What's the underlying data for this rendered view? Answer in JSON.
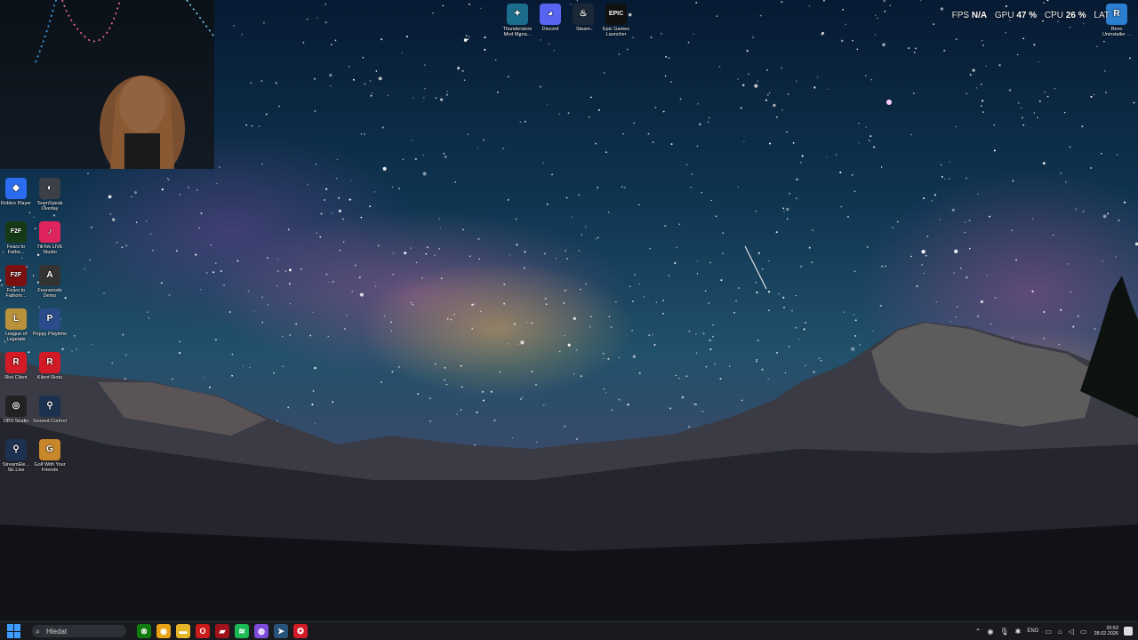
{
  "desktop": {
    "left_icons": [
      {
        "label": "Roblox Player",
        "color": "#2c6cf2",
        "glyph": "◆",
        "name": "roblox-player"
      },
      {
        "label": "TeamSpeak Overlay",
        "color": "#3b3f46",
        "glyph": "◐",
        "name": "teamspeak-overlay"
      },
      {
        "label": "Fears to Fatho...",
        "color": "#153a15",
        "glyph": "F2F",
        "name": "fears-to-fathom-1"
      },
      {
        "label": "TikTok LIVE Studio",
        "color": "#e0245e",
        "glyph": "♪",
        "name": "tiktok-live-studio"
      },
      {
        "label": "Fears to Fathom...",
        "color": "#7a1010",
        "glyph": "F2F",
        "name": "fears-to-fathom-2"
      },
      {
        "label": "Fearwoods Demo",
        "color": "#333",
        "glyph": "A",
        "name": "fearwoods-demo"
      },
      {
        "label": "League of Legends",
        "color": "#b8913a",
        "glyph": "L",
        "name": "league-of-legends"
      },
      {
        "label": "Poppy Playtime",
        "color": "#2a4c8c",
        "glyph": "P",
        "name": "poppy-playtime"
      },
      {
        "label": "Riot Client",
        "color": "#d21b27",
        "glyph": "R",
        "name": "riot-client"
      },
      {
        "label": "Klient Riotu",
        "color": "#d21b27",
        "glyph": "R",
        "name": "klient-riotu"
      },
      {
        "label": "OBS Studio",
        "color": "#222",
        "glyph": "◎",
        "name": "obs-studio"
      },
      {
        "label": "Ground Control",
        "color": "#1d3250",
        "glyph": "⚲",
        "name": "ground-control"
      },
      {
        "label": "StreamEle... SE.Live",
        "color": "#1d3250",
        "glyph": "⚲",
        "name": "streamelements-selive"
      },
      {
        "label": "Golf With Your Friends",
        "color": "#c8872a",
        "glyph": "G",
        "name": "golf-with-your-friends"
      }
    ],
    "top_icons": [
      {
        "label": "Thunderstore Mod Mana...",
        "color": "#1a6e8c",
        "glyph": "✦",
        "name": "thunderstore-mod-manager"
      },
      {
        "label": "Discord",
        "color": "#5865f2",
        "glyph": "◕",
        "name": "discord"
      },
      {
        "label": "Steam",
        "color": "#1b2838",
        "glyph": "♨",
        "name": "steam"
      },
      {
        "label": "Epic Games Launcher",
        "color": "#111",
        "glyph": "EPIC",
        "name": "epic-games-launcher"
      }
    ],
    "right_icon": {
      "label": "Revo Uninstaller ...",
      "color": "#2b7fd0",
      "glyph": "R",
      "name": "revo-uninstaller"
    }
  },
  "hud": {
    "fps_label": "FPS",
    "fps_value": "N/A",
    "gpu_label": "GPU",
    "gpu_value": "47 %",
    "cpu_label": "CPU",
    "cpu_value": "26 %",
    "lat_label": "LAT"
  },
  "taskbar": {
    "search_placeholder": "Hledat",
    "apps": [
      {
        "name": "xbox-icon",
        "color": "#107c10",
        "glyph": "⊗"
      },
      {
        "name": "chrome-icon",
        "color": "#e8a317",
        "glyph": "◉"
      },
      {
        "name": "file-explorer-icon",
        "color": "#e5b427",
        "glyph": "▬"
      },
      {
        "name": "opera-icon",
        "color": "#cc1b1b",
        "glyph": "O"
      },
      {
        "name": "red-app-icon",
        "color": "#a0121a",
        "glyph": "▰"
      },
      {
        "name": "spotify-icon",
        "color": "#1db954",
        "glyph": "≋"
      },
      {
        "name": "chat-app-icon",
        "color": "#7d4cdb",
        "glyph": "◍"
      },
      {
        "name": "steam-taskbar-icon",
        "color": "#27527a",
        "glyph": "➤"
      },
      {
        "name": "riot-taskbar-icon",
        "color": "#d21b27",
        "glyph": "✪"
      }
    ],
    "language": "ENG",
    "time": "20:52",
    "date": "28.02.2026"
  }
}
